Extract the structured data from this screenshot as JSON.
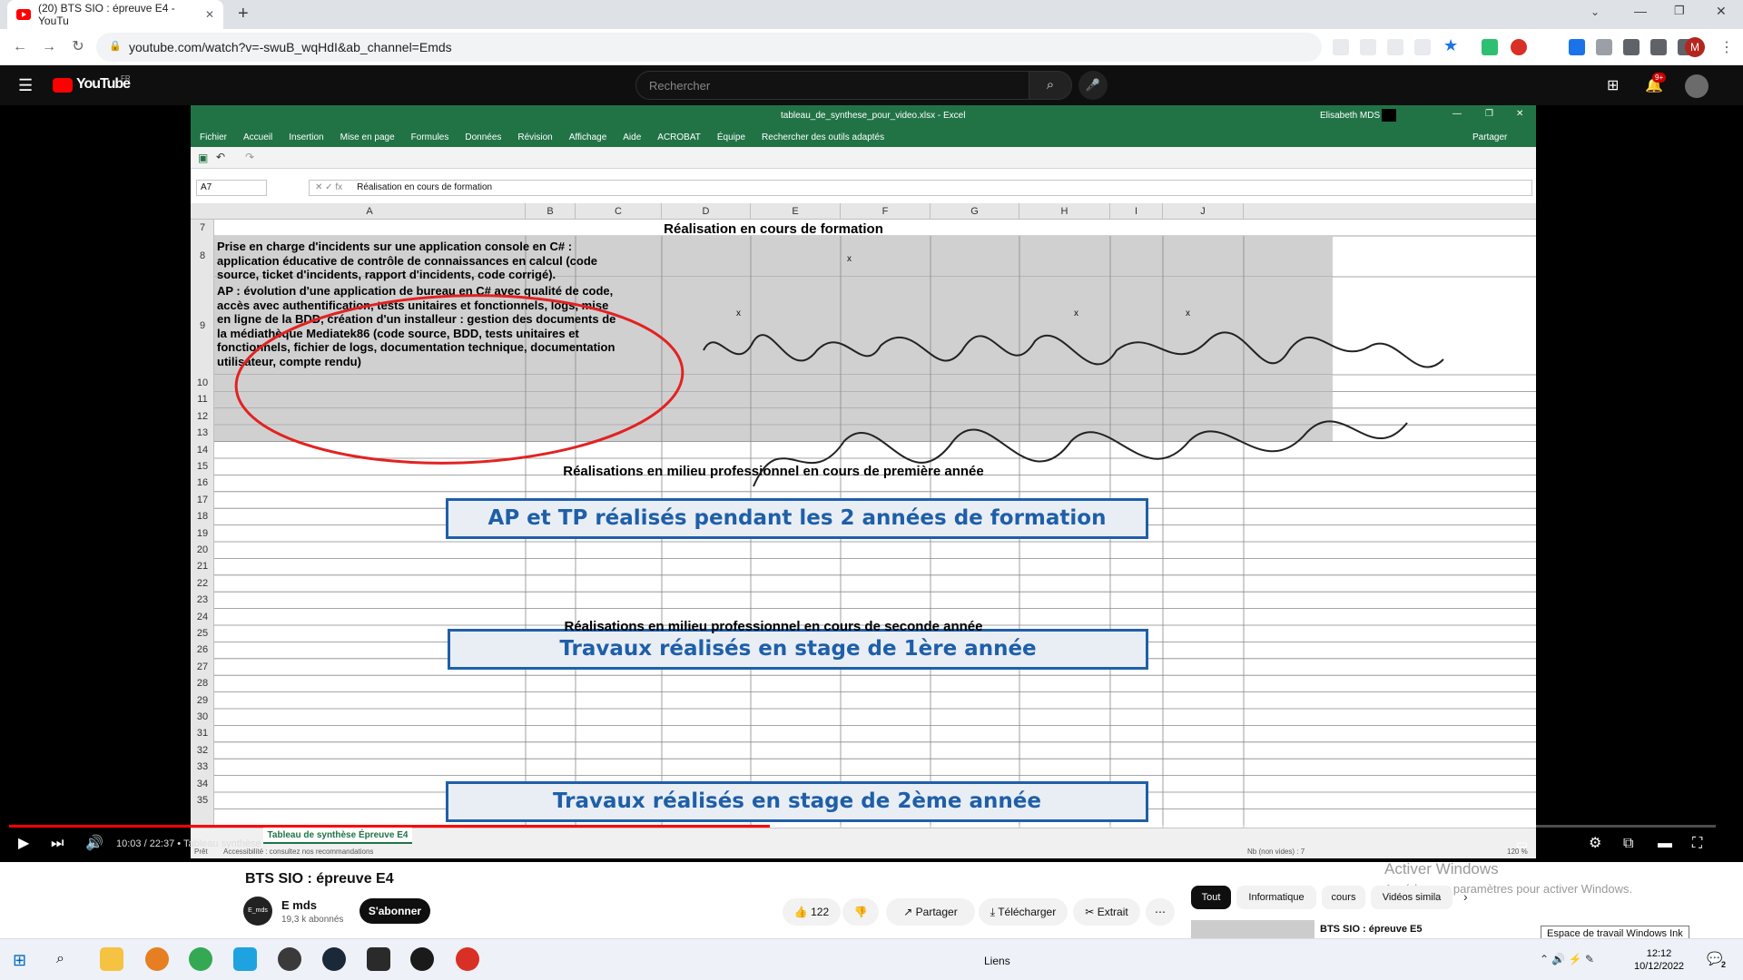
{
  "browser": {
    "tab_title": "(20) BTS SIO : épreuve E4 - YouTu",
    "new_tab": "+",
    "url": "youtube.com/watch?v=-swuB_wqHdI&ab_channel=Emds",
    "profile_initial": "M"
  },
  "youtube": {
    "logo": "YouTube",
    "region": "FR",
    "search_placeholder": "Rechercher",
    "notif_badge": "9+"
  },
  "excel": {
    "file_title": "tableau_de_synthese_pour_video.xlsx - Excel",
    "user": "Elisabeth MDS",
    "menu": [
      "Fichier",
      "Accueil",
      "Insertion",
      "Mise en page",
      "Formules",
      "Données",
      "Révision",
      "Affichage",
      "Aide",
      "ACROBAT",
      "Équipe",
      "Rechercher des outils adaptés"
    ],
    "share": "Partager",
    "name_box": "A7",
    "formula_value": "Réalisation en cours de formation",
    "columns": [
      "A",
      "B",
      "C",
      "D",
      "E",
      "F",
      "G",
      "H",
      "I",
      "J"
    ],
    "rows": [
      "7",
      "8",
      "9",
      "10",
      "11",
      "12",
      "13",
      "14",
      "15",
      "16",
      "17",
      "18",
      "19",
      "20",
      "21",
      "22",
      "23",
      "24",
      "25",
      "26",
      "27",
      "28",
      "29",
      "30",
      "31",
      "32",
      "33",
      "34",
      "35"
    ],
    "header_row7": "Réalisation en cours de formation",
    "row8_text": "Prise en charge d'incidents sur une application console en C# : application éducative de contrôle de connaissances en calcul (code source, ticket d'incidents, rapport d'incidents, code corrigé).",
    "row9_text": "AP : évolution d'une application de bureau en C# avec qualité de code, accès avec authentification, tests unitaires et fonctionnels, logs, mise en ligne de la BDD, création d'un installeur : gestion des documents de la médiathèque Mediatek86 (code source, BDD, tests unitaires et fonctionnels, fichier de logs, documentation technique, documentation utilisateur, compte rendu)",
    "mark": "x",
    "box1": "AP et TP réalisés pendant les 2 années de formation",
    "section_first_year": "Réalisations en milieu professionnel en cours de première année",
    "box2": "Travaux réalisés en stage de 1ère année",
    "section_second_year": "Réalisations en milieu professionnel en cours de seconde année",
    "box3": "Travaux réalisés en stage de 2ème année",
    "sheet_tab": "Tableau de synthèse Épreuve E4",
    "status_left": "Prêt",
    "status_accessibility": "Accessibilité : consultez nos recommandations",
    "status_right": "Nb (non vides) : 7",
    "zoom": "120 %"
  },
  "player": {
    "time": "10:03 / 22:37",
    "chapter": "• Tableau synthèse",
    "progress_fraction": 0.446
  },
  "video": {
    "title": "BTS SIO : épreuve E4",
    "channel": "E mds",
    "channel_avatar": "E_mds",
    "subscribers": "19,3 k abonnés",
    "subscribe": "S'abonner",
    "likes": "122",
    "share": "Partager",
    "download": "Télécharger",
    "clip": "Extrait",
    "more": "⋯"
  },
  "chips": [
    "Tout",
    "Informatique",
    "cours",
    "Vidéos simila"
  ],
  "next_video": "BTS SIO : épreuve E5",
  "windows": {
    "activate_title": "Activer Windows",
    "activate_sub": "Accéder aux paramètres pour activer Windows.",
    "ink_tooltip": "Espace de travail Windows Ink",
    "links": "Liens",
    "time": "12:12",
    "date": "10/12/2022",
    "notif_count": "2"
  }
}
